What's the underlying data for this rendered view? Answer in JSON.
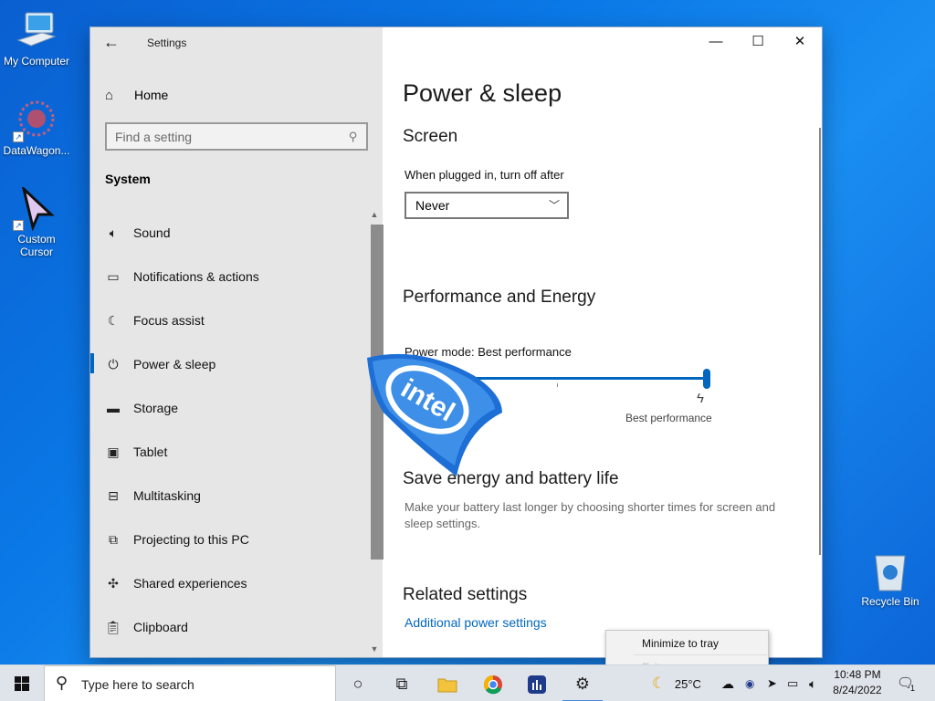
{
  "desktop": {
    "icons": [
      {
        "label": "My Computer"
      },
      {
        "label": "DataWagon..."
      },
      {
        "label": "Custom Cursor"
      }
    ],
    "recycle_bin": "Recycle Bin"
  },
  "window": {
    "app_title": "Settings",
    "home_label": "Home",
    "search_placeholder": "Find a setting",
    "section_label": "System",
    "nav_items": [
      {
        "label": "Sound",
        "icon": "speaker-icon"
      },
      {
        "label": "Notifications & actions",
        "icon": "message-icon"
      },
      {
        "label": "Focus assist",
        "icon": "moon-icon"
      },
      {
        "label": "Power & sleep",
        "icon": "power-icon",
        "active": true
      },
      {
        "label": "Storage",
        "icon": "storage-icon"
      },
      {
        "label": "Tablet",
        "icon": "tablet-icon"
      },
      {
        "label": "Multitasking",
        "icon": "multitasking-icon"
      },
      {
        "label": "Projecting to this PC",
        "icon": "projector-icon"
      },
      {
        "label": "Shared experiences",
        "icon": "shared-icon"
      },
      {
        "label": "Clipboard",
        "icon": "clipboard-icon"
      }
    ],
    "controls": {
      "minimize": "—",
      "maximize": "☐",
      "close": "✕"
    }
  },
  "page": {
    "title": "Power & sleep",
    "screen": {
      "heading": "Screen",
      "plugged_label": "When plugged in, turn off after",
      "plugged_value": "Never"
    },
    "performance": {
      "heading": "Performance and Energy",
      "mode_label": "Power mode: Best performance",
      "slider_end_label": "Best performance",
      "slider_value": 1.0
    },
    "battery": {
      "heading": "Save energy and battery life",
      "description": "Make your battery last longer by choosing shorter times for screen and sleep settings."
    },
    "related": {
      "heading": "Related settings",
      "link": "Additional power settings"
    }
  },
  "context_menu": {
    "items": [
      "Minimize to tray",
      "Exit"
    ]
  },
  "taskbar": {
    "search_placeholder": "Type here to search",
    "weather": "25°C",
    "time": "10:48 PM",
    "date": "8/24/2022",
    "notification_count": "1"
  },
  "colors": {
    "accent": "#0067c0",
    "nav_bg": "#e6e6e6",
    "desktop": "#0a78e6"
  }
}
